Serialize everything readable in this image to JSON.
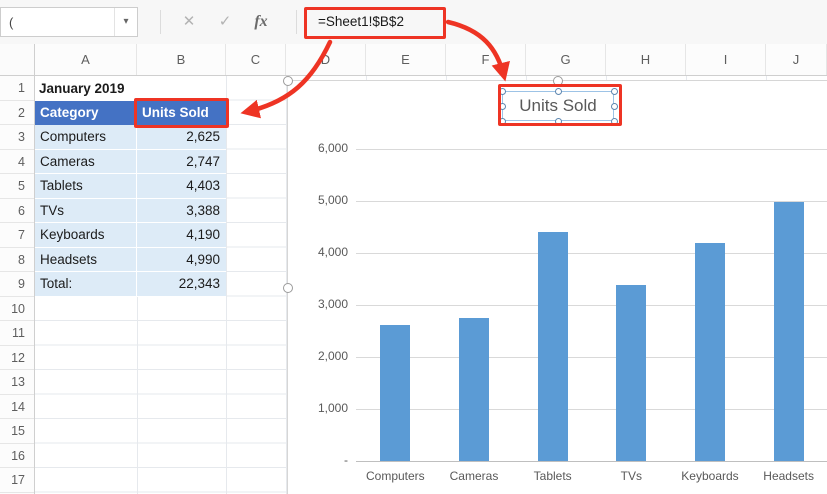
{
  "formula_bar": {
    "name_box": "(",
    "dropdown_icon": "▾",
    "cancel_icon": "✕",
    "enter_icon": "✓",
    "fx_icon": "fx",
    "formula": "=Sheet1!$B$2"
  },
  "sheet": {
    "column_headers": [
      "A",
      "B",
      "C",
      "D",
      "E",
      "F",
      "G",
      "H",
      "I",
      "J"
    ],
    "row_headers": [
      "1",
      "2",
      "3",
      "4",
      "5",
      "6",
      "7",
      "8",
      "9",
      "10",
      "11",
      "12",
      "13",
      "14",
      "15",
      "16",
      "17"
    ],
    "cells": {
      "a1": "January 2019"
    },
    "table": {
      "headers": [
        "Category",
        "Units Sold"
      ],
      "rows": [
        {
          "label": "Computers",
          "value": "2,625"
        },
        {
          "label": "Cameras",
          "value": "2,747"
        },
        {
          "label": "Tablets",
          "value": "4,403"
        },
        {
          "label": "TVs",
          "value": "3,388"
        },
        {
          "label": "Keyboards",
          "value": "4,190"
        },
        {
          "label": "Headsets",
          "value": "4,990"
        },
        {
          "label": "Total:",
          "value": "22,343"
        }
      ]
    }
  },
  "chart_data": {
    "type": "bar",
    "title": "Units Sold",
    "categories": [
      "Computers",
      "Cameras",
      "Tablets",
      "TVs",
      "Keyboards",
      "Headsets"
    ],
    "values": [
      2625,
      2747,
      4403,
      3388,
      4190,
      4990
    ],
    "ylim": [
      0,
      6000
    ],
    "yticks": [
      0,
      1000,
      2000,
      3000,
      4000,
      5000,
      6000
    ],
    "ytick_labels": [
      "-",
      "1,000",
      "2,000",
      "3,000",
      "4,000",
      "5,000",
      "6,000"
    ],
    "grid": true,
    "legend": false,
    "bar_color": "#5B9BD5"
  },
  "colors": {
    "table_header_fill": "#4472C4",
    "table_header_text": "#FFFFFF",
    "table_band_fill": "#DDEBF7",
    "annotation_red": "#EE3424",
    "bar_blue": "#5B9BD5",
    "axis_text": "#595959"
  }
}
